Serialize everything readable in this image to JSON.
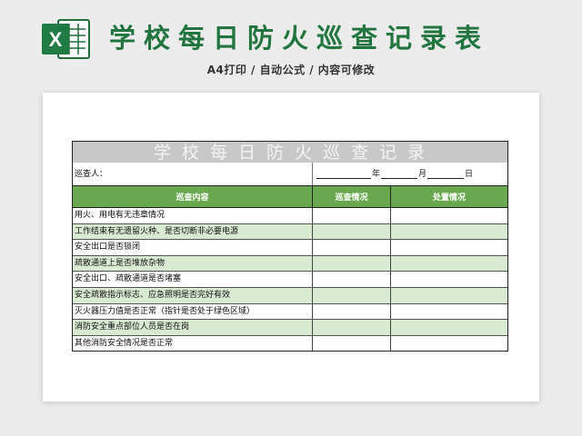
{
  "header": {
    "icon_letter": "X",
    "title": "学校每日防火巡查记录表",
    "subtitle": "A4打印 / 自动公式 / 内容可修改"
  },
  "form": {
    "title": "学校每日防火巡查记录",
    "inspector_label": "巡查人：",
    "date_units": {
      "year": "年",
      "month": "月",
      "day": "日"
    },
    "columns": [
      "巡查内容",
      "巡查情况",
      "处置情况"
    ],
    "rows": [
      {
        "content": "用火、用电有无违章情况",
        "status": "",
        "action": ""
      },
      {
        "content": "工作结束有无遗留火种、是否切断非必要电源",
        "status": "",
        "action": ""
      },
      {
        "content": "安全出口是否锁闭",
        "status": "",
        "action": ""
      },
      {
        "content": "疏散通道上是否堆放杂物",
        "status": "",
        "action": ""
      },
      {
        "content": "安全出口、疏散通道是否堵塞",
        "status": "",
        "action": ""
      },
      {
        "content": "安全疏散指示标志、应急照明是否完好有效",
        "status": "",
        "action": ""
      },
      {
        "content": "灭火器压力值是否正常（指针是否处于绿色区域）",
        "status": "",
        "action": ""
      },
      {
        "content": "消防安全重点部位人员是否在岗",
        "status": "",
        "action": ""
      },
      {
        "content": "其他消防安全情况是否正常",
        "status": "",
        "action": ""
      }
    ]
  },
  "colors": {
    "brand_green": "#22753f",
    "header_green": "#6aa84f",
    "alt_row_green": "#d9ead3",
    "title_gray": "#c8c8c8"
  }
}
